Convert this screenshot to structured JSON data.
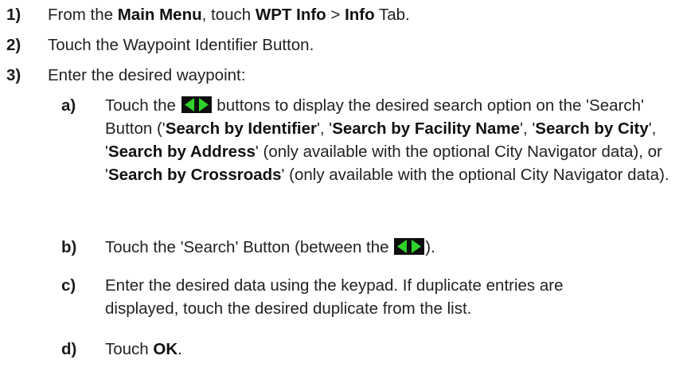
{
  "steps": [
    {
      "num": "1)",
      "t1": "From the ",
      "b1": "Main Menu",
      "t2": ", touch ",
      "b2": "WPT Info",
      "t3": " > ",
      "b3": "Info",
      "t4": " Tab."
    },
    {
      "num": "2)",
      "text": "Touch the Waypoint Identifier Button."
    },
    {
      "num": "3)",
      "text": "Enter the desired waypoint:"
    }
  ],
  "substeps": {
    "a": {
      "num": "a)",
      "t1": "Touch the ",
      "t2": " buttons to display the desired search option on the 'Search' Button ('",
      "b1": "Search by Identifier",
      "t3": "', '",
      "b2": "Search by Facility Name",
      "t4": "', '",
      "b3": "Search by City",
      "t5": "',  '",
      "b4": "Search by Address",
      "t6": "' (only available with the optional City Navigator data), or '",
      "b5": "Search by Crossroads",
      "t7": "' (only available with the optional City Navigator data)."
    },
    "b": {
      "num": "b)",
      "t1": "Touch the 'Search' Button (between the ",
      "t2": ")."
    },
    "c": {
      "num": "c)",
      "text": "Enter the desired data using the keypad.  If duplicate entries are displayed, touch the desired duplicate from the list."
    },
    "d": {
      "num": "d)",
      "t1": "Touch ",
      "b1": "OK",
      "t2": "."
    }
  },
  "icons": {
    "arrow_buttons": "left-right-arrow-buttons-icon",
    "arrow_color": "#2fd12a",
    "arrow_bg": "#0e0e0e"
  }
}
